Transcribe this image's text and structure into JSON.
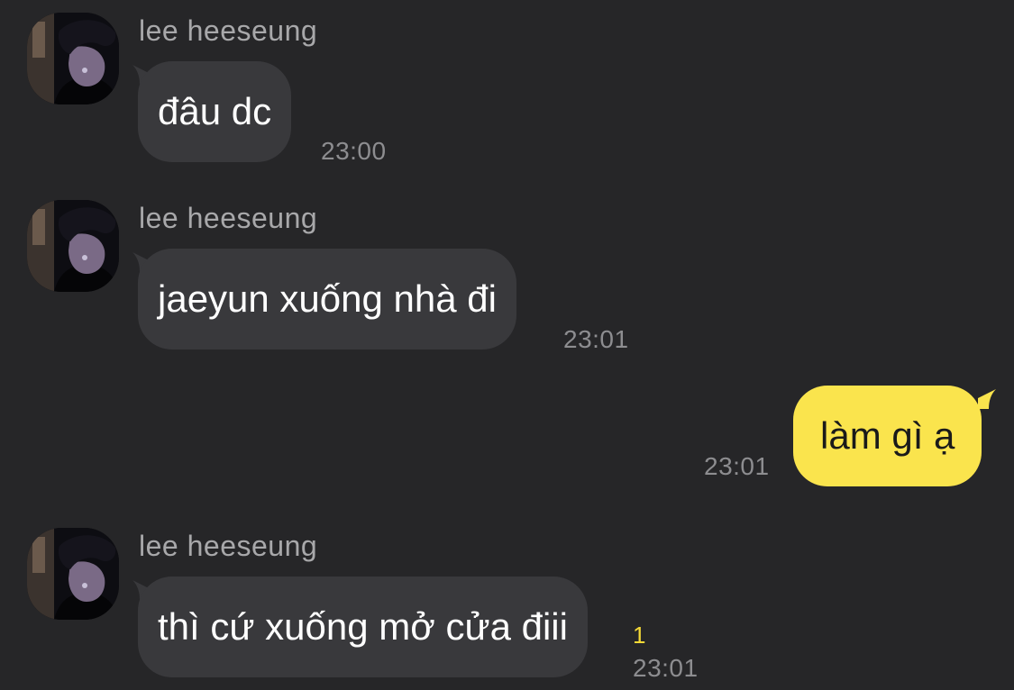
{
  "colors": {
    "background": "#262628",
    "incoming_bubble": "#39393c",
    "outgoing_bubble": "#fae44d",
    "unread_count": "#f5d936"
  },
  "messages": [
    {
      "direction": "incoming",
      "sender": "lee heeseung",
      "text": "đâu dc",
      "time": "23:00"
    },
    {
      "direction": "incoming",
      "sender": "lee heeseung",
      "text": "jaeyun xuống nhà đi",
      "time": "23:01"
    },
    {
      "direction": "outgoing",
      "text": "làm gì ạ",
      "time": "23:01"
    },
    {
      "direction": "incoming",
      "sender": "lee heeseung",
      "text": "thì cứ xuống mở cửa điii",
      "time": "23:01",
      "unread": "1"
    }
  ]
}
